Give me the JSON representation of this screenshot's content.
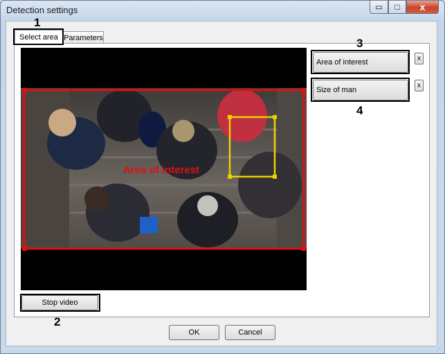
{
  "window": {
    "title": "Detection settings",
    "min_glyph": "▭",
    "max_glyph": "□",
    "close_glyph": "x"
  },
  "tabs": [
    {
      "label": "Select area",
      "active": true
    },
    {
      "label": "Parameters",
      "active": false
    }
  ],
  "callouts": {
    "n1": "1",
    "n2": "2",
    "n3": "3",
    "n4": "4"
  },
  "video": {
    "overlay_label": "Area of interest",
    "area_color": "#e01010",
    "size_color": "#f0d000"
  },
  "side_buttons": {
    "area_label": "Area of interest",
    "size_label": "Size of man",
    "remove_glyph": "x"
  },
  "stop_video_label": "Stop video",
  "footer": {
    "ok_label": "OK",
    "cancel_label": "Cancel"
  }
}
